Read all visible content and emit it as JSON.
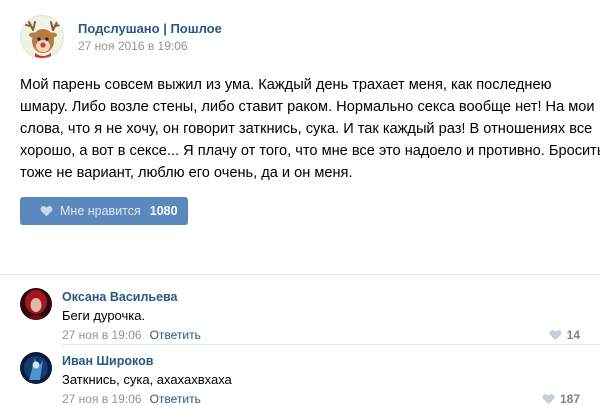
{
  "post": {
    "group_name": "Подслушано | Пошлое",
    "date": "27 ноя 2016 в 19:06",
    "avatar_icon": "reindeer-icon",
    "text_lines": [
      "Мой парень совсем выжил из ума. Каждый день трахает меня, как последнею",
      "шмару. Либо возле стены, либо ставит раком. Нормально секса вообще нет! На мои",
      "слова, что я не хочу, он говорит заткнись, сука. И так каждый раз! В отношениях все",
      "хорошо, а вот в сексе... Я плачу от того, что мне все это надоело и противно. Бросить",
      "тоже не вариант, люблю его очень, да и он меня."
    ],
    "like_button": {
      "label": "Мне нравится",
      "count": "1080",
      "icon": "heart-icon"
    }
  },
  "comments": [
    {
      "author": "Оксана Васильева",
      "text": "Беги дурочка.",
      "date": "27 ноя в 19:06",
      "reply_label": "Ответить",
      "likes": "14"
    },
    {
      "author": "Иван Широков",
      "text": "Заткнись, сука, ахахахвхаха",
      "date": "27 ноя в 19:06",
      "reply_label": "Ответить",
      "likes": "187"
    }
  ],
  "colors": {
    "link": "#2a5885",
    "button": "#5b88bd",
    "meta": "#939393",
    "divider": "#e7e8ec"
  }
}
